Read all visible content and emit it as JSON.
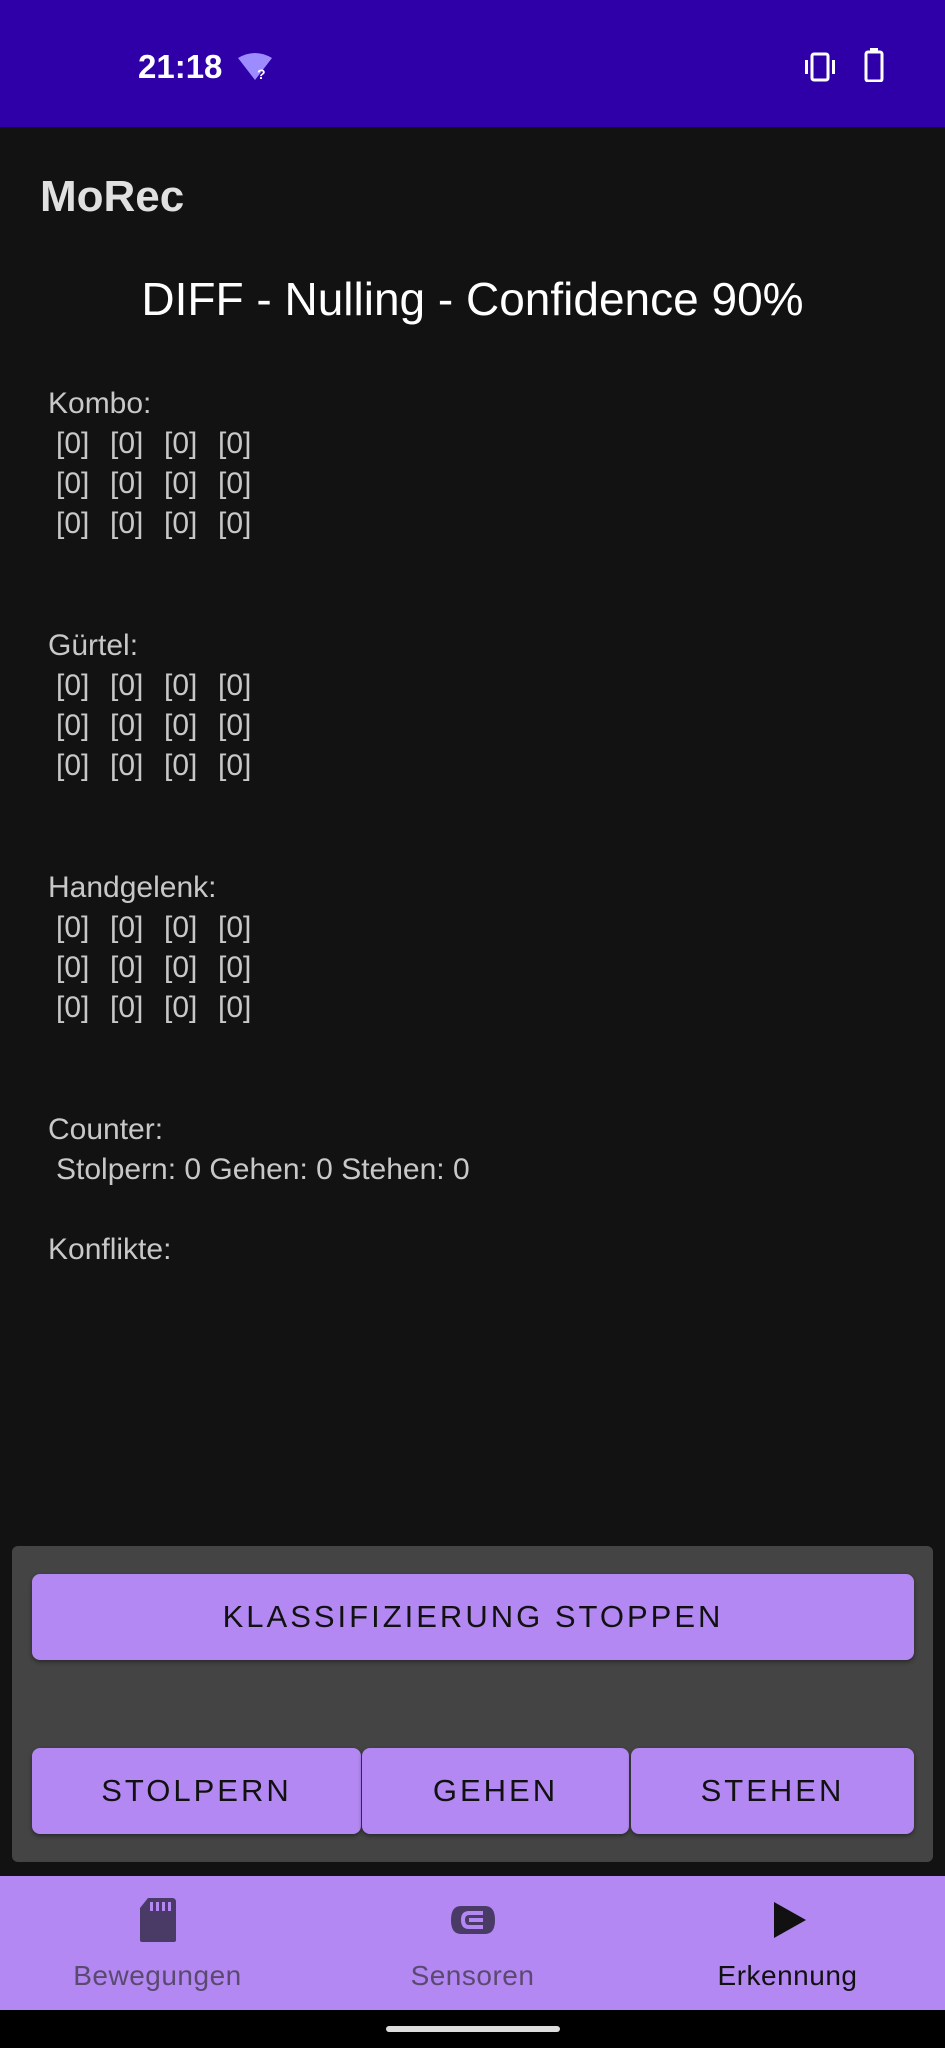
{
  "status_bar": {
    "time": "21:18"
  },
  "app_title": "MoRec",
  "mode_title": "DIFF - Nulling - Confidence 90%",
  "sections": [
    {
      "label": "Kombo:",
      "rows": [
        [
          "[0]",
          "[0]",
          "[0]",
          "[0]"
        ],
        [
          "[0]",
          "[0]",
          "[0]",
          "[0]"
        ],
        [
          "[0]",
          "[0]",
          "[0]",
          "[0]"
        ]
      ]
    },
    {
      "label": "Gürtel:",
      "rows": [
        [
          "[0]",
          "[0]",
          "[0]",
          "[0]"
        ],
        [
          "[0]",
          "[0]",
          "[0]",
          "[0]"
        ],
        [
          "[0]",
          "[0]",
          "[0]",
          "[0]"
        ]
      ]
    },
    {
      "label": "Handgelenk:",
      "rows": [
        [
          "[0]",
          "[0]",
          "[0]",
          "[0]"
        ],
        [
          "[0]",
          "[0]",
          "[0]",
          "[0]"
        ],
        [
          "[0]",
          "[0]",
          "[0]",
          "[0]"
        ]
      ]
    }
  ],
  "counter": {
    "label": "Counter:",
    "text": "Stolpern: 0 Gehen: 0 Stehen: 0"
  },
  "conflicts": {
    "label": "Konflikte:"
  },
  "buttons": {
    "stop": "KLASSIFIZIERUNG STOPPEN",
    "stolpern": "STOLPERN",
    "gehen": "GEHEN",
    "stehen": "STEHEN"
  },
  "nav": {
    "items": [
      {
        "label": "Bewegungen",
        "icon": "sd-card-icon"
      },
      {
        "label": "Sensoren",
        "icon": "sensor-icon"
      },
      {
        "label": "Erkennung",
        "icon": "play-icon",
        "active": true
      }
    ]
  },
  "colors": {
    "status_bar": "#2f00a8",
    "accent": "#b388f2",
    "background": "#121212",
    "panel": "#444444"
  }
}
